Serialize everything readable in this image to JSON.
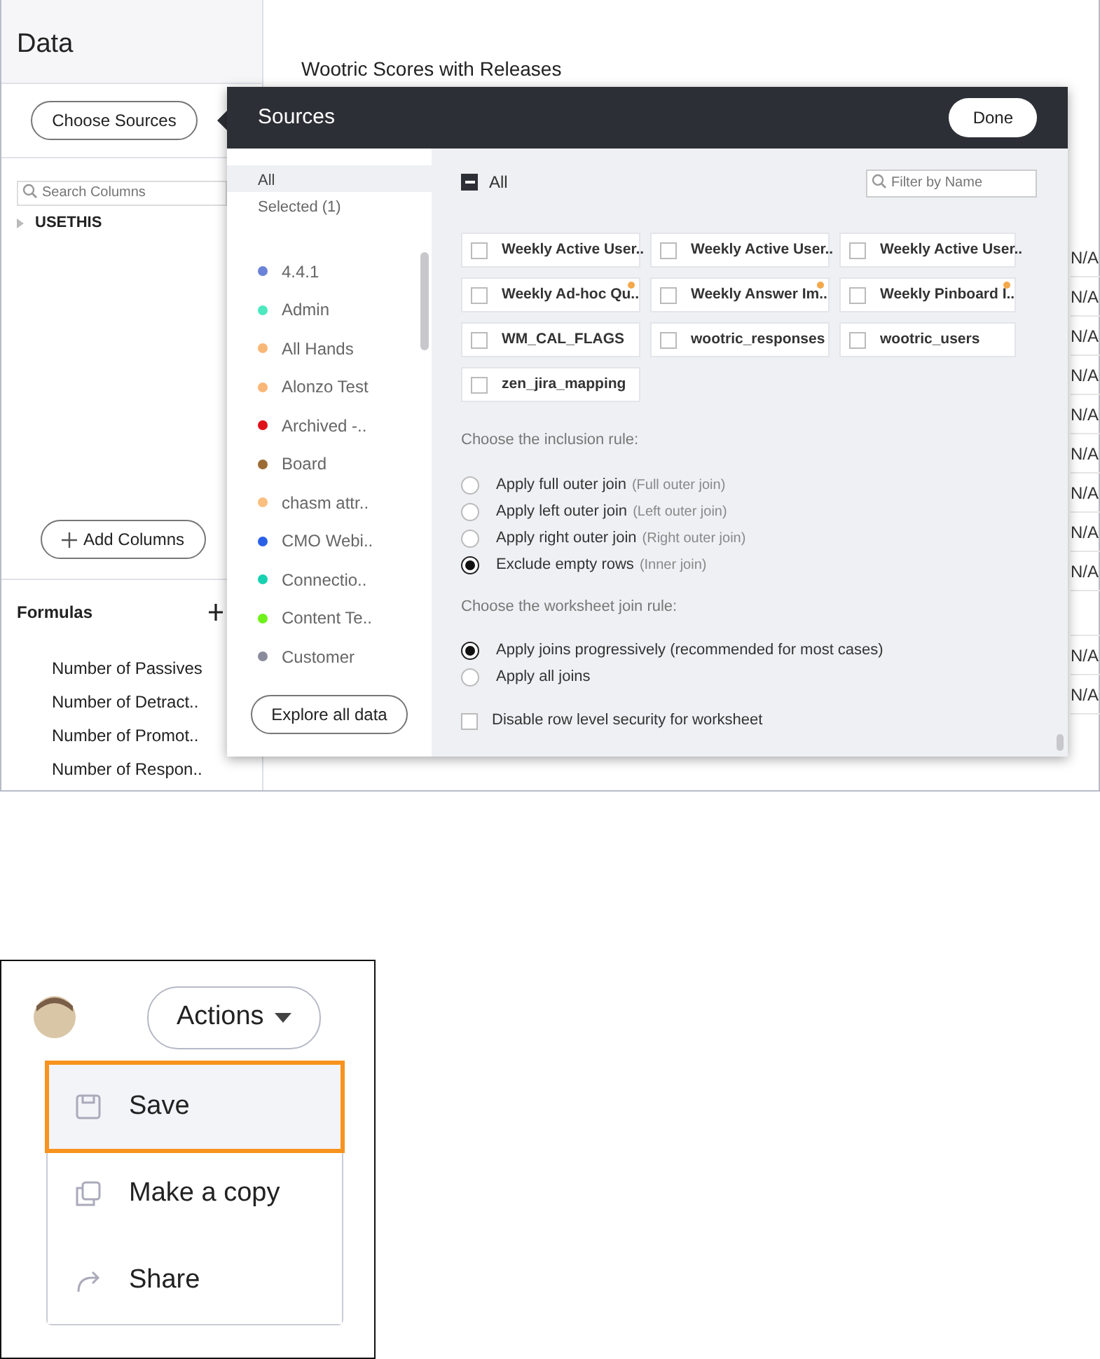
{
  "data_panel": {
    "title": "Data",
    "choose_sources_button": "Choose Sources",
    "search": {
      "placeholder": "Search Columns"
    },
    "tree": [
      {
        "label": "USETHIS",
        "expanded": false
      }
    ],
    "add_columns_button": "Add Columns",
    "formulas": {
      "title": "Formulas",
      "items": [
        "Number of Passives",
        "Number of Detract..",
        "Number of Promot..",
        "Number of Respon.."
      ]
    }
  },
  "worksheet": {
    "title": "Wootric Scores with Releases",
    "column_block_1": [
      "N/A",
      "N/A",
      "N/A",
      "N/A",
      "N/A",
      "N/A",
      "N/A",
      "N/A",
      "N/A"
    ],
    "column_block_2": [
      "N/A",
      "N/A"
    ]
  },
  "sources_popover": {
    "title": "Sources",
    "done_button": "Done",
    "filters": [
      {
        "label": "All",
        "selected": true
      },
      {
        "label": "Selected (1)",
        "selected": false
      }
    ],
    "sources": [
      {
        "name": "4.4.1",
        "color": "#6a82d8"
      },
      {
        "name": "Admin",
        "color": "#4de8c0"
      },
      {
        "name": "All Hands",
        "color": "#f9b777"
      },
      {
        "name": "Alonzo Test",
        "color": "#f9b777"
      },
      {
        "name": "Archived -..",
        "color": "#e0101a"
      },
      {
        "name": "Board",
        "color": "#9c6b35"
      },
      {
        "name": "chasm attr..",
        "color": "#fbbf80"
      },
      {
        "name": "CMO Webi..",
        "color": "#2a5fe8"
      },
      {
        "name": "Connectio..",
        "color": "#18d1b0"
      },
      {
        "name": "Content Te..",
        "color": "#6ef21a"
      },
      {
        "name": "Customer",
        "color": "#8a8c9c"
      }
    ],
    "explore_button": "Explore all data",
    "all_checkbox": {
      "label": "All",
      "partial": true
    },
    "filter": {
      "placeholder": "Filter by Name"
    },
    "tables": [
      {
        "name": "Weekly Active User..",
        "checked": false,
        "flagged": false
      },
      {
        "name": "Weekly Active User..",
        "checked": false,
        "flagged": false
      },
      {
        "name": "Weekly Active User..",
        "checked": false,
        "flagged": false
      },
      {
        "name": "Weekly Ad-hoc Qu..",
        "checked": false,
        "flagged": true
      },
      {
        "name": "Weekly Answer Im..",
        "checked": false,
        "flagged": true
      },
      {
        "name": "Weekly Pinboard I..",
        "checked": false,
        "flagged": true
      },
      {
        "name": "WM_CAL_FLAGS",
        "checked": false,
        "flagged": false
      },
      {
        "name": "wootric_responses",
        "checked": false,
        "flagged": false
      },
      {
        "name": "wootric_users",
        "checked": false,
        "flagged": false
      },
      {
        "name": "zen_jira_mapping",
        "checked": false,
        "flagged": false
      }
    ],
    "inclusion_rule": {
      "heading": "Choose the inclusion rule:",
      "options": [
        {
          "label": "Apply full outer join",
          "note": "(Full outer join)",
          "selected": false
        },
        {
          "label": "Apply left outer join",
          "note": "(Left outer join)",
          "selected": false
        },
        {
          "label": "Apply right outer join",
          "note": "(Right outer join)",
          "selected": false
        },
        {
          "label": "Exclude empty rows",
          "note": "(Inner join)",
          "selected": true
        }
      ]
    },
    "join_rule": {
      "heading": "Choose the worksheet join rule:",
      "options": [
        {
          "label": "Apply joins progressively (recommended for most cases)",
          "selected": true
        },
        {
          "label": "Apply all joins",
          "selected": false
        }
      ]
    },
    "row_security": {
      "label": "Disable row level security for worksheet",
      "checked": false
    }
  },
  "actions_menu": {
    "button": "Actions",
    "items": [
      {
        "label": "Save",
        "highlighted": true
      },
      {
        "label": "Make a copy",
        "highlighted": false
      },
      {
        "label": "Share",
        "highlighted": false
      }
    ]
  }
}
